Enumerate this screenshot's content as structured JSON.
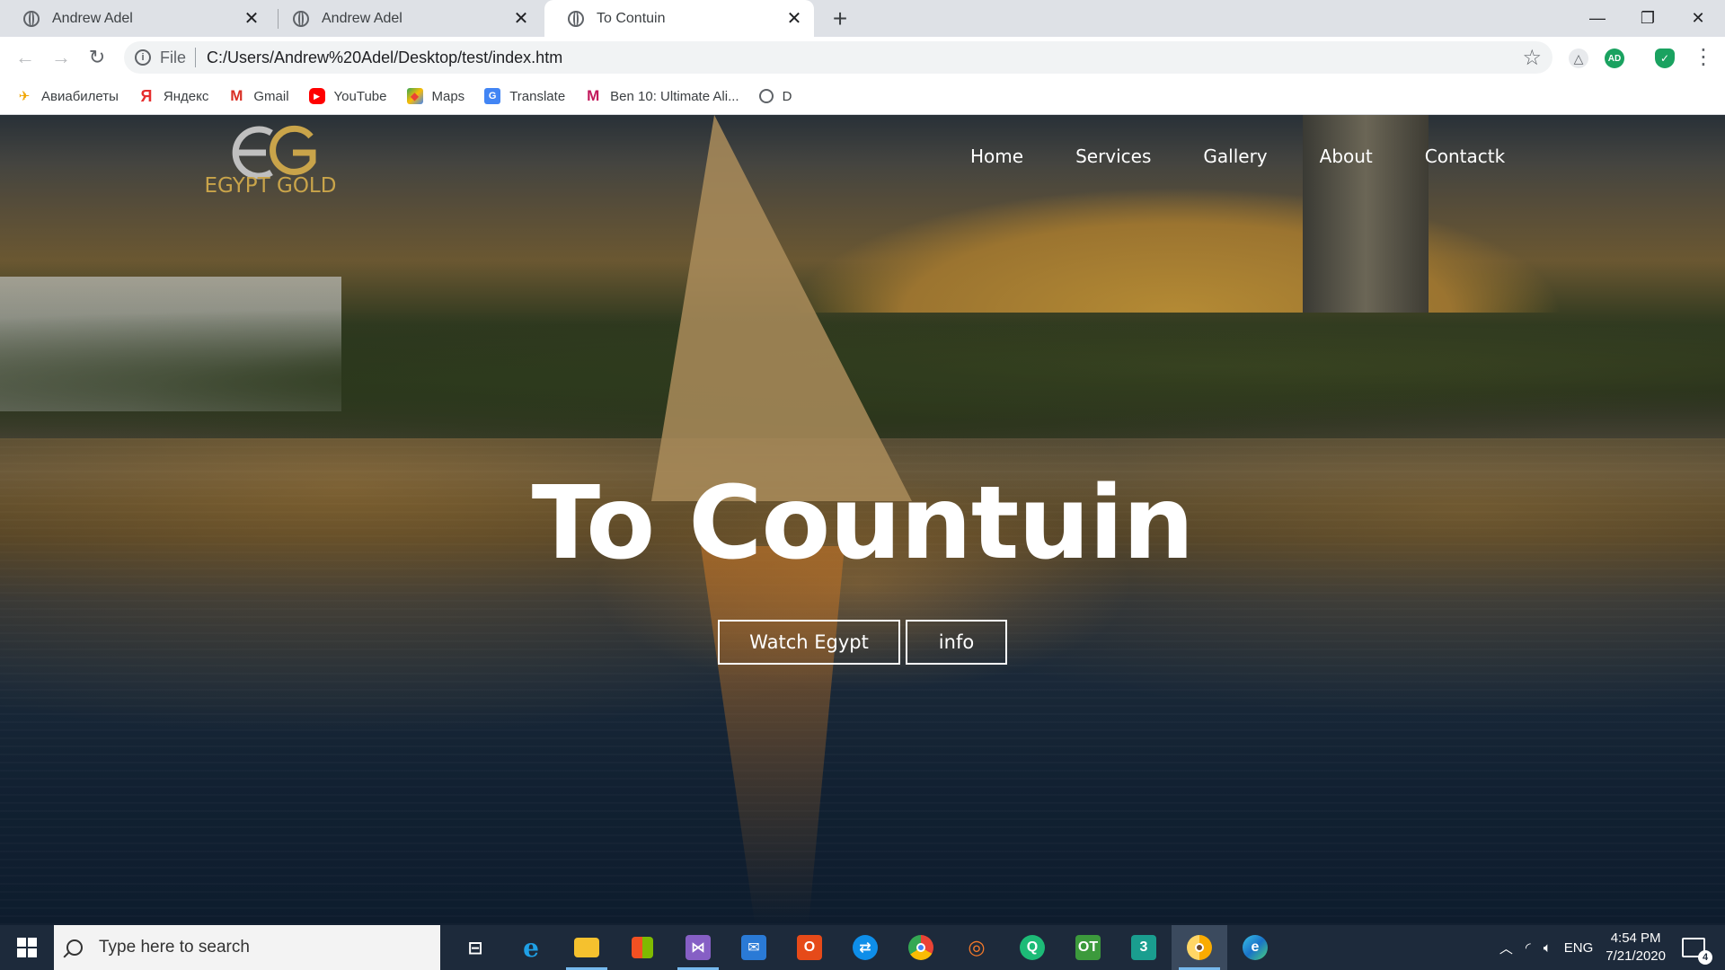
{
  "browser": {
    "tabs": [
      {
        "title": "Andrew Adel",
        "active": false
      },
      {
        "title": "Andrew Adel",
        "active": false
      },
      {
        "title": "To Contuin",
        "active": true
      }
    ],
    "address": {
      "scheme": "File",
      "url": "C:/Users/Andrew%20Adel/Desktop/test/index.htm"
    },
    "extensions": [
      {
        "name": "drive-icon"
      },
      {
        "name": "profile-avatar",
        "label": "AD",
        "color": "#1aa260"
      },
      {
        "name": "shield-icon",
        "color": "#1aa260"
      }
    ],
    "bookmarks": [
      {
        "label": "Авиабилеты",
        "icon": "plane-icon"
      },
      {
        "label": "Яндекс",
        "icon": "yandex-icon"
      },
      {
        "label": "Gmail",
        "icon": "gmail-icon"
      },
      {
        "label": "YouTube",
        "icon": "youtube-icon"
      },
      {
        "label": "Maps",
        "icon": "maps-icon"
      },
      {
        "label": "Translate",
        "icon": "translate-icon"
      },
      {
        "label": "Ben 10: Ultimate Ali...",
        "icon": "ben10-icon"
      },
      {
        "label": "D",
        "icon": "globe-icon"
      }
    ]
  },
  "site": {
    "logo": {
      "text": "EGYPT GOLD"
    },
    "nav": [
      "Home",
      "Services",
      "Gallery",
      "About",
      "Contactk"
    ],
    "hero": {
      "title": "To Countuin",
      "buttons": {
        "watch": "Watch Egypt",
        "info": "info"
      }
    },
    "colors": {
      "gold": "#c9a44a",
      "nav_text": "#ffffff"
    }
  },
  "taskbar": {
    "search_placeholder": "Type here to search",
    "apps": [
      "task-view-icon",
      "internet-explorer-icon",
      "file-explorer-icon",
      "store-icon",
      "visual-studio-icon",
      "mail-icon",
      "office-icon",
      "teamviewer-icon",
      "chrome-icon",
      "blender-icon",
      "app-q-icon",
      "app-ot-icon",
      "app-3-icon",
      "chrome-canary-icon",
      "edge-icon"
    ],
    "tray": {
      "language": "ENG",
      "time": "4:54 PM",
      "date": "7/21/2020",
      "notifications": "4"
    }
  }
}
